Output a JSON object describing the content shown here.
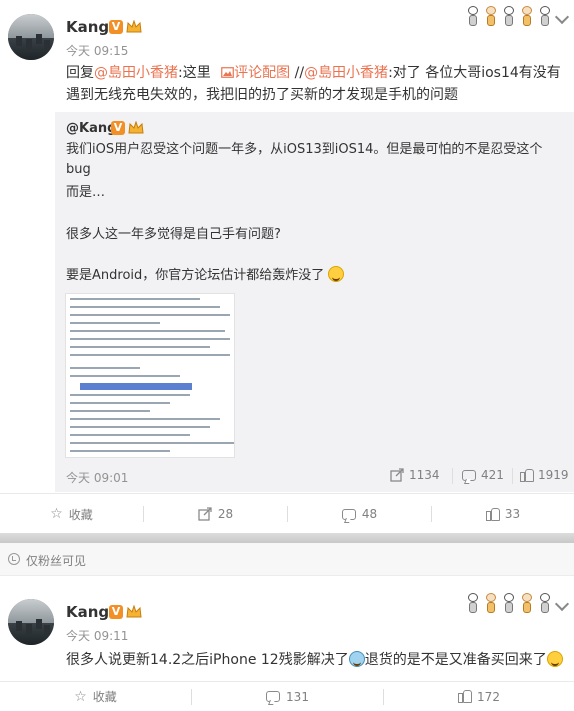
{
  "post1": {
    "author": "Kang",
    "verified_badge": "V",
    "time": "今天 09:15",
    "text_prefix": "回复",
    "mention1": "@島田小香猪",
    "text_mid1": ":这里",
    "image_comment_link": "评论配图",
    "text_mid2": " //",
    "mention2": "@島田小香猪",
    "text_line1_rest": ":对了 各位大哥ios14有没有",
    "text_line2": "遇到无线充电失效的，我把旧的扔了买新的才发现是手机的问题",
    "quoted": {
      "author": "@Kang",
      "line1": "我们iOS用户忍受这个问题一年多，从iOS13到iOS14。但是最可怕的不是忍受这个bug",
      "line2": "而是…",
      "line3": "很多人这一年多觉得是自己手有问题?",
      "line4": "要是Android，你官方论坛估计都给轰炸没了",
      "time": "今天 09:01",
      "reposts": "1134",
      "comments": "421",
      "likes": "1919"
    },
    "actions": {
      "favorite": "收藏",
      "repost": "28",
      "comment": "48",
      "like": "33"
    }
  },
  "fans_only": "仅粉丝可见",
  "post2": {
    "author": "Kang",
    "verified_badge": "V",
    "time": "今天 09:11",
    "text_part1": "很多人说更新14.2之后iPhone 12残影解决了",
    "text_part2": "退货的是不是又准备买回来了",
    "actions": {
      "favorite": "收藏",
      "comment": "131",
      "like": "172"
    }
  },
  "colors": {
    "link": "#eb7350",
    "badge": "#f28f26",
    "quote_bg": "#f2f2f5"
  }
}
